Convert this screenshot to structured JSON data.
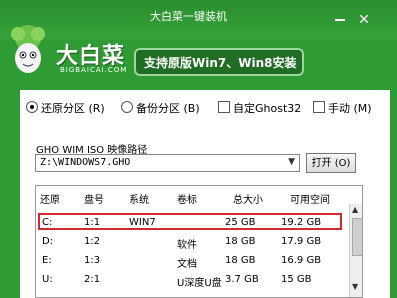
{
  "window": {
    "title": "大白菜一键装机"
  },
  "header": {
    "brand": "大白菜",
    "brand_sub": "BIGBAICAI.COM",
    "banner": "支持原版Win7、Win8安装"
  },
  "options": {
    "restore": "还原分区 (R)",
    "backup": "备份分区 (B)",
    "ghost32": "自定Ghost32",
    "manual": "手动 (M)",
    "selected": "restore"
  },
  "image": {
    "label": "GHO WIM ISO 映像路径",
    "path": "Z:\\WINDOWS7.GHO",
    "open_button": "打开 (O)"
  },
  "table": {
    "headers": [
      "还原",
      "盘号",
      "系统",
      "卷标",
      "总大小",
      "可用空间"
    ],
    "rows": [
      [
        "C:",
        "1:1",
        "WIN7",
        "",
        "25 GB",
        "19.2 GB"
      ],
      [
        "D:",
        "1:2",
        "",
        "软件",
        "18 GB",
        "17.9 GB"
      ],
      [
        "E:",
        "1:3",
        "",
        "文档",
        "18 GB",
        "16.9 GB"
      ],
      [
        "U:",
        "2:1",
        "",
        "U深度U盘",
        "3.7 GB",
        "15 GB"
      ]
    ],
    "selected_row": 0
  },
  "colors": {
    "accent": "#2f9b34",
    "selection_border": "#d22a2a"
  }
}
